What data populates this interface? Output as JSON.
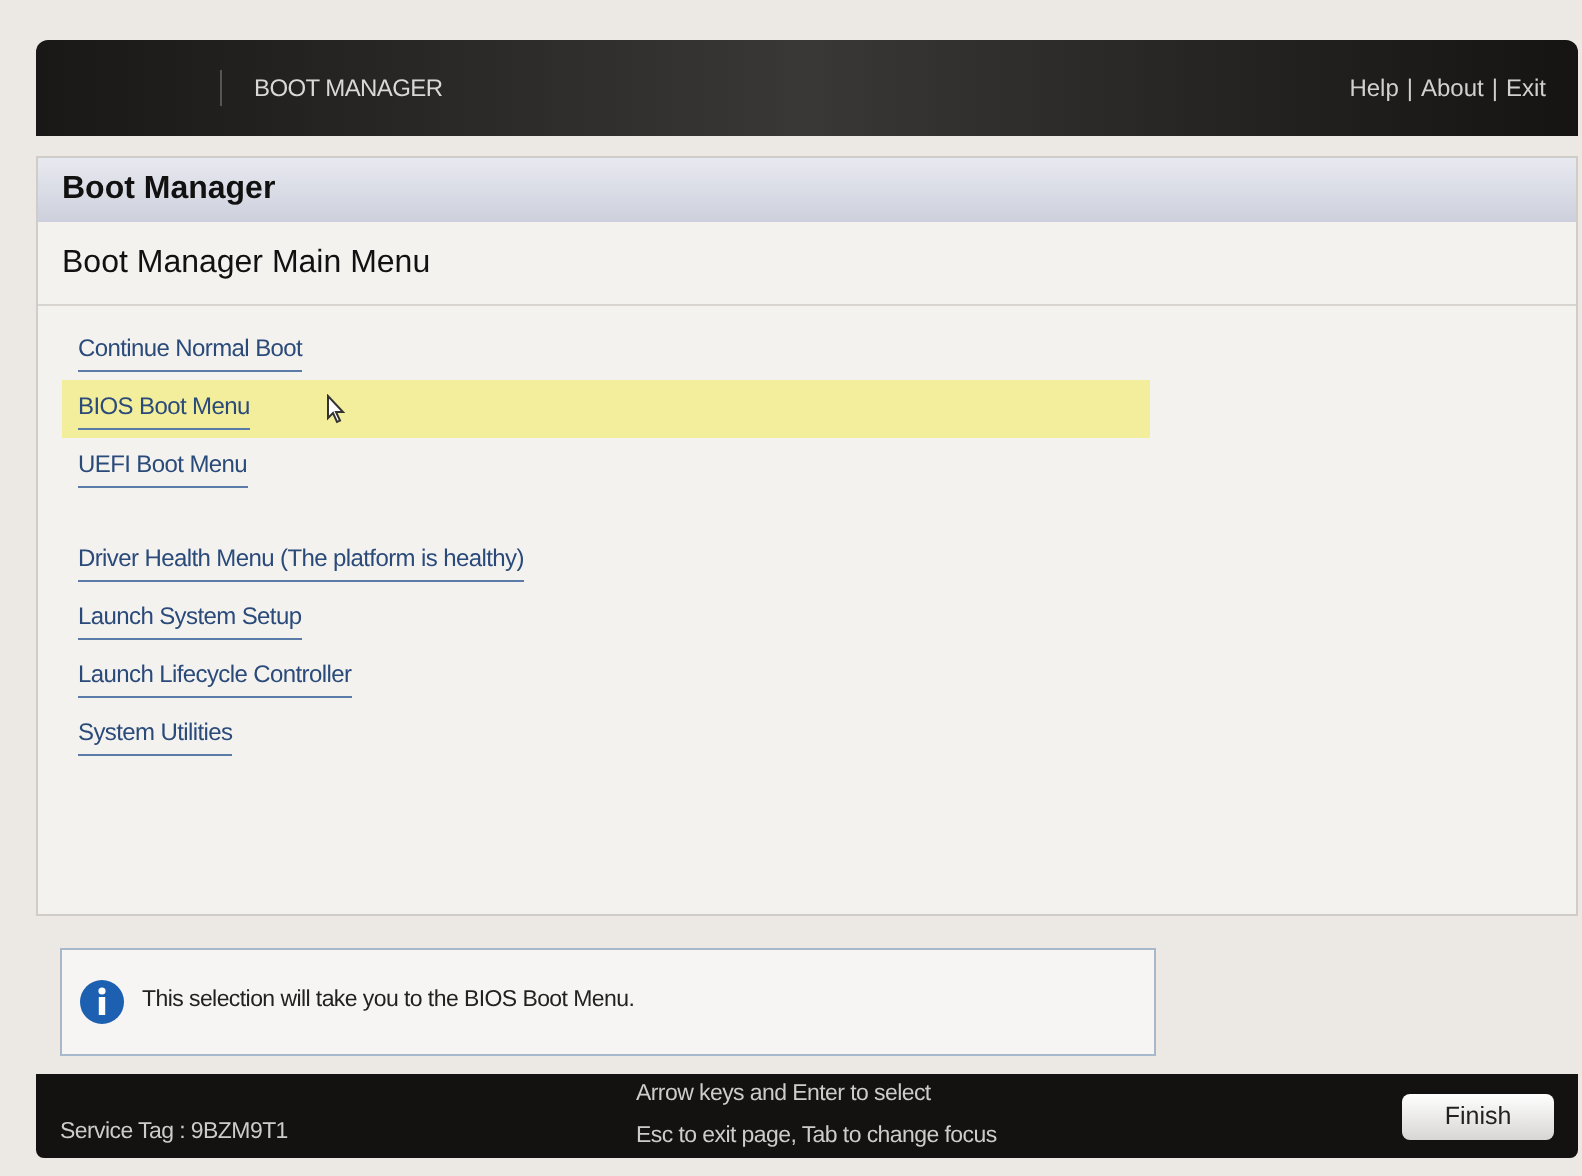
{
  "header": {
    "title": "BOOT MANAGER",
    "links": [
      "Help",
      "About",
      "Exit"
    ],
    "separator": "|"
  },
  "page": {
    "title": "Boot Manager",
    "subtitle": "Boot Manager Main Menu"
  },
  "menu_groups": [
    {
      "items": [
        {
          "label": "Continue Normal Boot",
          "selected": false
        },
        {
          "label": "BIOS Boot Menu",
          "selected": true
        },
        {
          "label": "UEFI Boot Menu",
          "selected": false
        }
      ]
    },
    {
      "items": [
        {
          "label": "Driver Health Menu (The platform is healthy)",
          "selected": false
        },
        {
          "label": "Launch System Setup",
          "selected": false
        },
        {
          "label": "Launch Lifecycle Controller",
          "selected": false
        },
        {
          "label": "System Utilities",
          "selected": false
        }
      ]
    }
  ],
  "help_message": "This selection will take you to the BIOS Boot Menu.",
  "footer": {
    "service_tag": "Service Tag : 9BZM9T1",
    "hints": [
      "Arrow keys and Enter to select",
      "Esc to exit page, Tab to change focus"
    ],
    "button": "Finish"
  }
}
